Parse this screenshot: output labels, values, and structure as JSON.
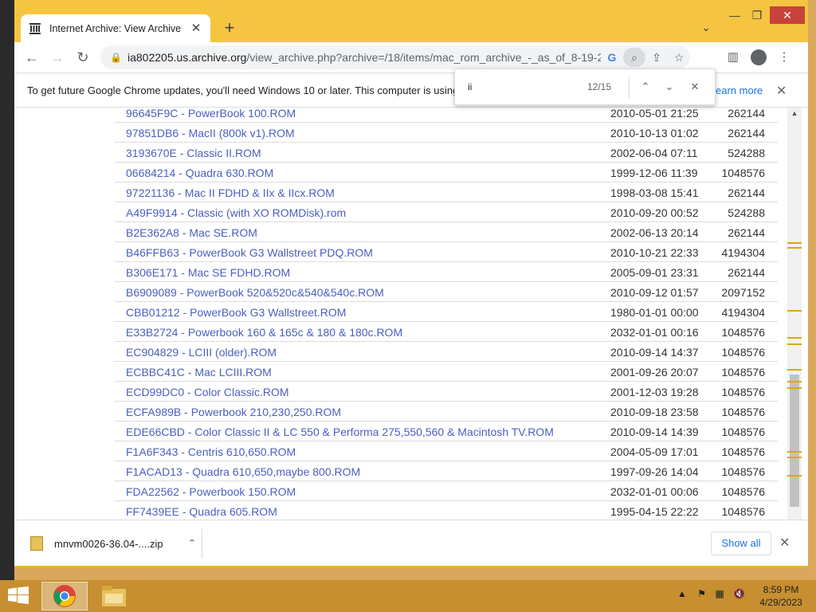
{
  "browser": {
    "tab_title": "Internet Archive: View Archive",
    "url_host": "ia802205.us.archive.org",
    "url_rest": "/view_archive.php?archive=/18/items/mac_rom_archive_-_as_of_8-19-201..."
  },
  "infobar": {
    "text": "To get future Google Chrome updates, you'll need Windows 10 or later. This computer is using",
    "link": "earn more"
  },
  "findbar": {
    "query": "ii",
    "count": "12/15"
  },
  "files": [
    {
      "name": "96645F9C - PowerBook 100.ROM",
      "date": "2010-05-01 21:25",
      "size": "262144"
    },
    {
      "name": "97851DB6 - MacII (800k v1).ROM",
      "date": "2010-10-13 01:02",
      "size": "262144"
    },
    {
      "name": "3193670E - Classic II.ROM",
      "date": "2002-06-04 07:11",
      "size": "524288"
    },
    {
      "name": "06684214 - Quadra 630.ROM",
      "date": "1999-12-06 11:39",
      "size": "1048576"
    },
    {
      "name": "97221136 - Mac II FDHD & IIx & IIcx.ROM",
      "date": "1998-03-08 15:41",
      "size": "262144"
    },
    {
      "name": "A49F9914 - Classic (with XO ROMDisk).rom",
      "date": "2010-09-20 00:52",
      "size": "524288"
    },
    {
      "name": "B2E362A8 - Mac SE.ROM",
      "date": "2002-06-13 20:14",
      "size": "262144"
    },
    {
      "name": "B46FFB63 - PowerBook G3 Wallstreet PDQ.ROM",
      "date": "2010-10-21 22:33",
      "size": "4194304"
    },
    {
      "name": "B306E171 - Mac SE FDHD.ROM",
      "date": "2005-09-01 23:31",
      "size": "262144"
    },
    {
      "name": "B6909089 - PowerBook 520&520c&540&540c.ROM",
      "date": "2010-09-12 01:57",
      "size": "2097152"
    },
    {
      "name": "CBB01212 - PowerBook G3 Wallstreet.ROM",
      "date": "1980-01-01 00:00",
      "size": "4194304"
    },
    {
      "name": "E33B2724 - Powerbook 160 & 165c & 180 & 180c.ROM",
      "date": "2032-01-01 00:16",
      "size": "1048576"
    },
    {
      "name": "EC904829 - LCIII (older).ROM",
      "date": "2010-09-14 14:37",
      "size": "1048576"
    },
    {
      "name": "ECBBC41C - Mac LCIII.ROM",
      "date": "2001-09-26 20:07",
      "size": "1048576"
    },
    {
      "name": "ECD99DC0 - Color Classic.ROM",
      "date": "2001-12-03 19:28",
      "size": "1048576"
    },
    {
      "name": "ECFA989B - Powerbook 210,230,250.ROM",
      "date": "2010-09-18 23:58",
      "size": "1048576"
    },
    {
      "name": "EDE66CBD - Color Classic II & LC 550 & Performa 275,550,560 & Macintosh TV.ROM",
      "date": "2010-09-14 14:39",
      "size": "1048576"
    },
    {
      "name": "F1A6F343 - Centris 610,650.ROM",
      "date": "2004-05-09 17:01",
      "size": "1048576"
    },
    {
      "name": "F1ACAD13 - Quadra 610,650,maybe 800.ROM",
      "date": "1997-09-26 14:04",
      "size": "1048576"
    },
    {
      "name": "FDA22562 - Powerbook 150.ROM",
      "date": "2032-01-01 00:06",
      "size": "1048576"
    },
    {
      "name": "FF7439EE - Quadra 605.ROM",
      "date": "1995-04-15 22:22",
      "size": "1048576"
    }
  ],
  "downloads": {
    "file": "mnvm0026-36.04-....zip",
    "show_all": "Show all"
  },
  "taskbar": {
    "time": "8:59 PM",
    "date": "4/29/2023"
  }
}
